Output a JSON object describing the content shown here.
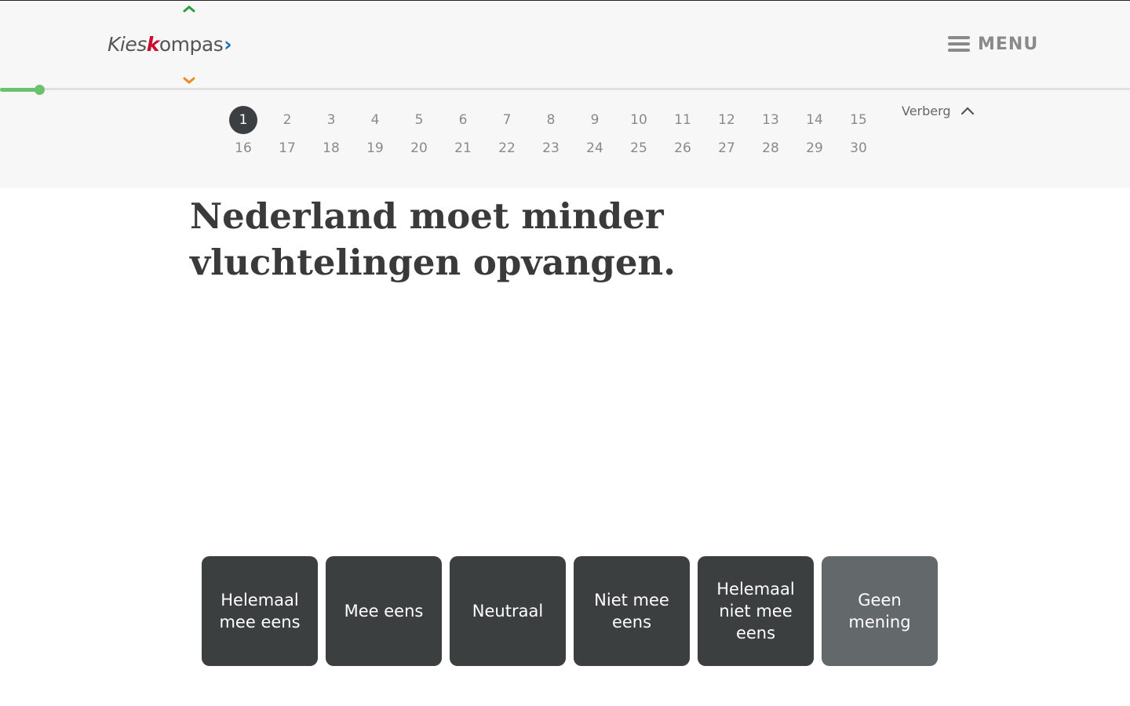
{
  "header": {
    "logo": {
      "part1": "Kies",
      "part2": "k",
      "part3": "ompas",
      "arrow": "›"
    },
    "menu_label": "MENU"
  },
  "progress": {
    "fraction": 0.033
  },
  "nav": {
    "questions": [
      "1",
      "2",
      "3",
      "4",
      "5",
      "6",
      "7",
      "8",
      "9",
      "10",
      "11",
      "12",
      "13",
      "14",
      "15",
      "16",
      "17",
      "18",
      "19",
      "20",
      "21",
      "22",
      "23",
      "24",
      "25",
      "26",
      "27",
      "28",
      "29",
      "30"
    ],
    "active": 1,
    "hide_label": "Verberg"
  },
  "statement": "Nederland moet minder vluchtelingen opvangen.",
  "answers": {
    "strongly_agree": "Helemaal mee eens",
    "agree": "Mee eens",
    "neutral": "Neutraal",
    "disagree": "Niet mee eens",
    "strongly_disagree": "Helemaal niet mee eens",
    "no_opinion": "Geen mening"
  },
  "colors": {
    "accent_green": "#6cc26c",
    "up_chevron": "#2e9e3e",
    "down_chevron": "#f08a24",
    "button_dark": "#3b3f40",
    "button_muted": "#63686a"
  }
}
